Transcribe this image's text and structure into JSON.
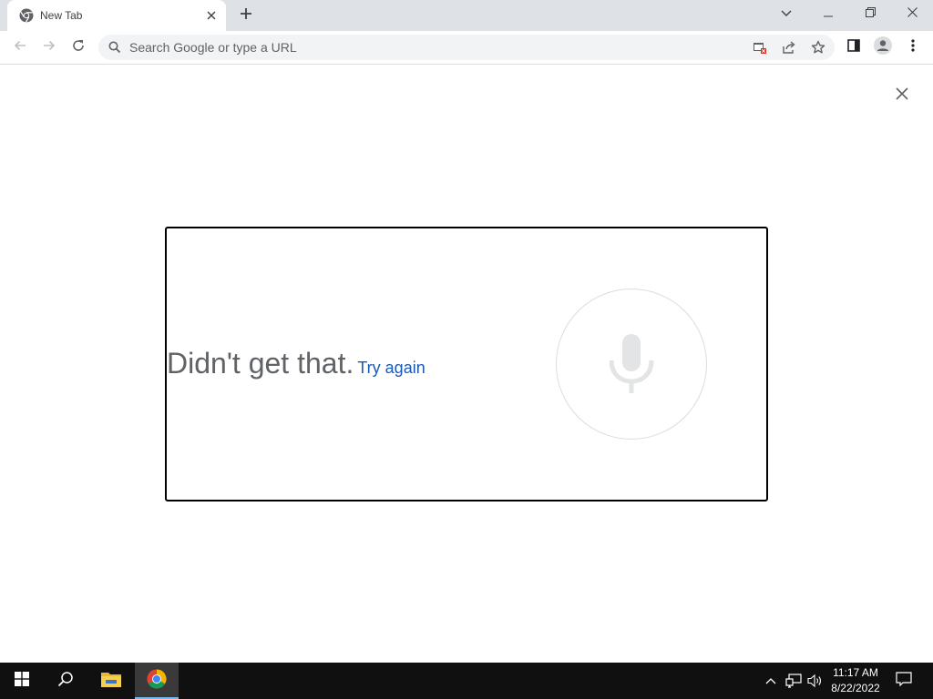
{
  "browser": {
    "tab_title": "New Tab",
    "omnibox_placeholder": "Search Google or type a URL"
  },
  "voice_search": {
    "status_text": "Didn't get that.",
    "retry_label": "Try again"
  },
  "taskbar": {
    "time": "11:17 AM",
    "date": "8/22/2022"
  },
  "colors": {
    "tabstrip_bg": "#dee1e6",
    "omnibox_bg": "#f1f3f4",
    "link_blue": "#1a5ab5",
    "status_gray": "#5f6368",
    "taskbar_bg": "#101010"
  },
  "icons": [
    "chrome-icon",
    "close-icon",
    "plus-icon",
    "chevron-down-icon",
    "minimize-icon",
    "restore-icon",
    "back-arrow-icon",
    "forward-arrow-icon",
    "reload-icon",
    "search-icon",
    "popup-blocked-icon",
    "share-icon",
    "star-icon",
    "side-panel-icon",
    "profile-icon",
    "more-vert-icon",
    "microphone-icon",
    "windows-start-icon",
    "file-explorer-icon",
    "chevron-up-icon",
    "network-icon",
    "volume-icon",
    "notification-icon"
  ]
}
